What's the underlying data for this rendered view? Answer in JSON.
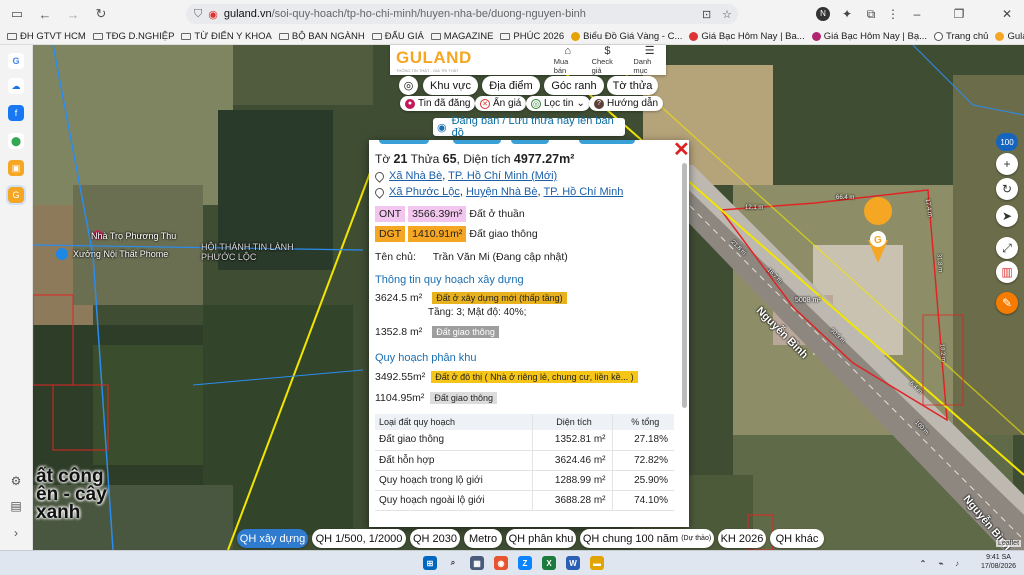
{
  "browser": {
    "url_host": "guland.vn",
    "url_path": "/soi-quy-hoach/tp-ho-chi-minh/huyen-nha-be/duong-nguyen-binh",
    "profile_initial": "N",
    "bookmarks": [
      {
        "label": "ĐH GTVT HCM",
        "type": "folder"
      },
      {
        "label": "TĐG D.NGHIỆP",
        "type": "folder"
      },
      {
        "label": "TỪ ĐIỂN Y KHOA",
        "type": "folder"
      },
      {
        "label": "BỘ BAN NGÀNH",
        "type": "folder"
      },
      {
        "label": "ĐẤU GIÁ",
        "type": "folder"
      },
      {
        "label": "MAGAZINE",
        "type": "folder"
      },
      {
        "label": "PHÚC 2026",
        "type": "folder"
      },
      {
        "label": "Biểu Đồ Giá Vàng - C...",
        "type": "site"
      },
      {
        "label": "Giá Bạc Hôm Nay | Ba...",
        "type": "site"
      },
      {
        "label": "Giá Bạc Hôm Nay | Bạ...",
        "type": "site"
      },
      {
        "label": "Trang chủ",
        "type": "site"
      },
      {
        "label": "Guland.vn - Bản Đồ Q...",
        "type": "site"
      }
    ]
  },
  "header": {
    "logo": "GULAND",
    "logo_tagline": "THÔNG TIN THẬT - GIÁ TRỊ THẬT",
    "buttons": [
      {
        "label": "Mua bán",
        "icon": "store-icon"
      },
      {
        "label": "Check giá",
        "icon": "dollar-icon"
      },
      {
        "label": "Danh mục",
        "icon": "menu-icon"
      }
    ]
  },
  "map_filters": {
    "main": [
      "Khu vực",
      "Địa điểm",
      "Góc ranh",
      "Tờ thửa"
    ],
    "sub": [
      "Tin đã đăng",
      "Ẩn giá",
      "Lọc tin",
      "Hướng dẫn"
    ],
    "post_button": "Đăng bán / Lưu thửa này lên bản đồ"
  },
  "parcel": {
    "to_label": "Tờ",
    "to": "21",
    "thua_label": "Thửa",
    "thua": "65",
    "area_label": "Diện tích",
    "area": "4977.27m²",
    "locations": [
      {
        "parts": [
          "Xã Nhà Bè",
          "TP. Hồ Chí Minh (Mới)"
        ]
      },
      {
        "parts": [
          "Xã Phước Lộc",
          "Huyện Nhà Bè",
          "TP. Hồ Chí Minh"
        ]
      }
    ],
    "land_types": [
      {
        "code": "ONT",
        "area": "3566.39m²",
        "desc": "Đất ở thuần",
        "color": "#f3c6f0"
      },
      {
        "code": "DGT",
        "area": "1410.91m²",
        "desc": "Đất giao thông",
        "color": "#f5a623"
      }
    ],
    "owner_label": "Tên chủ:",
    "owner": "Trần Văn Mi (Đang cập nhật)",
    "plan_build_title": "Thông tin quy hoạch xây dựng",
    "plan_build": [
      {
        "area": "3624.5 m²",
        "badge": "Đất ở xây dựng mới (thấp tầng)",
        "color": "#e8b11e",
        "detail": "Tầng: 3; Mật độ: 40%;"
      },
      {
        "area": "1352.8 m²",
        "badge": "Đất giao thông",
        "color": "#9e9e9e",
        "detail": ""
      }
    ],
    "plan_zone_title": "Quy hoạch phân khu",
    "plan_zone": [
      {
        "area": "3492.55m²",
        "badge": "Đất ở đô thị ( Nhà ở riêng lẻ, chung cư, liền kề... )",
        "color": "#f5c518"
      },
      {
        "area": "1104.95m²",
        "badge": "Đất giao thông",
        "color": "#dcdcdc"
      }
    ],
    "table": {
      "headers": [
        "Loại đất quy hoạch",
        "Diện tích",
        "% tổng"
      ],
      "rows": [
        [
          "Đất giao thông",
          "1352.81 m²",
          "27.18%"
        ],
        [
          "Đất hỗn hợp",
          "3624.46 m²",
          "72.82%"
        ],
        [
          "Quy hoạch trong lộ giới",
          "1288.99 m²",
          "25.90%"
        ],
        [
          "Quy hoạch ngoài lộ giới",
          "3688.28 m²",
          "74.10%"
        ]
      ]
    }
  },
  "map_labels": {
    "road": "Nguyễn Bình",
    "road2": "Nguyễn Bình",
    "nha_tro": "Nhà Trọ Phương Thu",
    "xuong": "Xưởng Nội Thất Phome",
    "hoi_thanh": "HỘI THÁNH TIN LÀNH PHƯỚC LỘC",
    "big_text_1": "ất công",
    "big_text_2": "ên - cây",
    "big_text_3": "xanh",
    "lot_area": "5008 m²",
    "dims": [
      "12.1 m",
      "66.4 m",
      "17.4 m",
      "31.8 m",
      "21.8 m",
      "16.7 m",
      "30.9 m",
      "6.4 m",
      "18.2 m",
      "100 m"
    ]
  },
  "right_tools": {
    "zoom": "100",
    "icons": [
      "plus-icon",
      "refresh-icon",
      "locate-icon",
      "expand-icon",
      "trash-icon",
      "pencil-icon"
    ]
  },
  "bottom_tabs": [
    {
      "label": "QH xây dựng",
      "active": true
    },
    {
      "label": "QH 1/500, 1/2000",
      "active": false
    },
    {
      "label": "QH 2030",
      "active": false
    },
    {
      "label": "Metro",
      "active": false
    },
    {
      "label": "QH phân khu",
      "active": false
    },
    {
      "label": "QH chung 100 năm",
      "sub": "(Dự thảo)",
      "active": false
    },
    {
      "label": "KH 2026",
      "active": false
    },
    {
      "label": "QH khác",
      "active": false
    }
  ],
  "attribution": "Leaflet",
  "taskbar": {
    "time": "9:41 SA",
    "date": "17/08/2026"
  }
}
